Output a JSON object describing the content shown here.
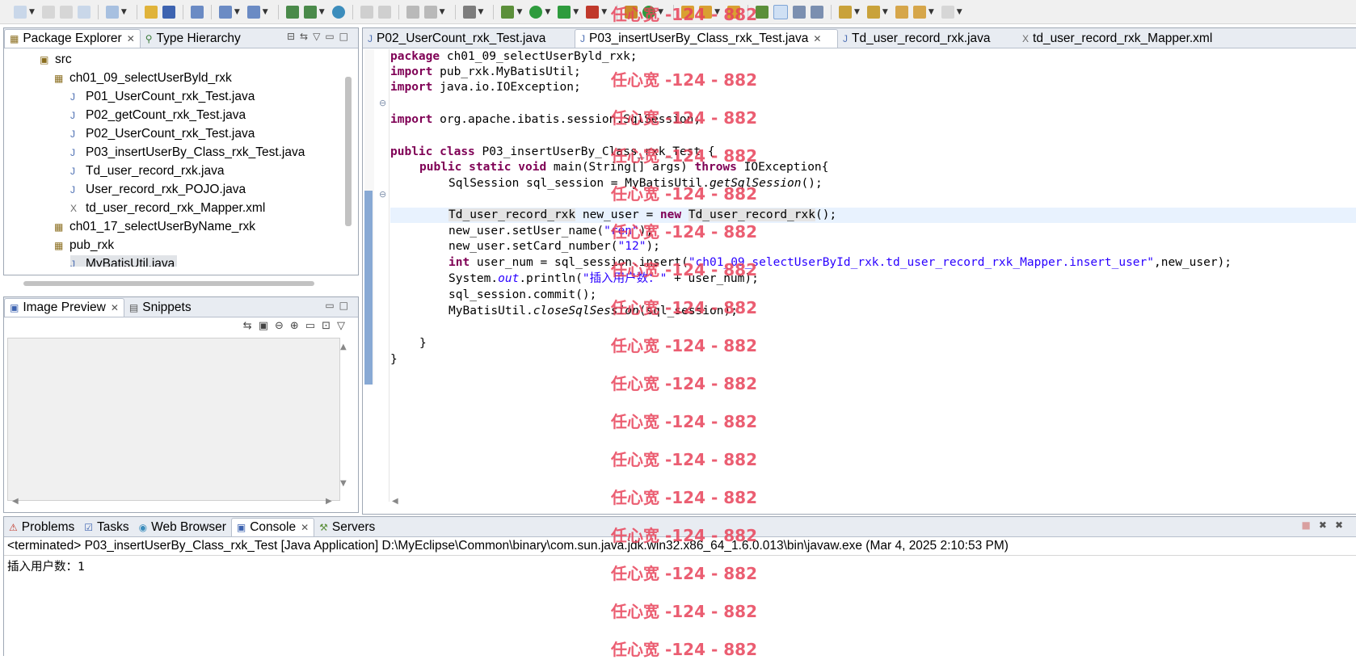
{
  "toolbar": {
    "icons": [
      "new-icon",
      "save-icon",
      "save-all-icon",
      "print-icon",
      "new-wizard-icon",
      "package-icon",
      "class-icon",
      "open-type-icon",
      "search-icon",
      "debug-icon",
      "run-icon",
      "run-as-icon",
      "external-tools-icon",
      "web-icon",
      "back-icon",
      "forward-icon"
    ]
  },
  "package_explorer": {
    "tab_label": "Package Explorer",
    "tab2_label": "Type Hierarchy",
    "items": [
      {
        "label": "src",
        "icon": "source-folder-icon"
      },
      {
        "label": "ch01_09_selectUserByld_rxk",
        "icon": "package-icon"
      },
      {
        "label": "P01_UserCount_rxk_Test.java",
        "icon": "java-file-icon"
      },
      {
        "label": "P02_getCount_rxk_Test.java",
        "icon": "java-file-icon"
      },
      {
        "label": "P02_UserCount_rxk_Test.java",
        "icon": "java-file-icon"
      },
      {
        "label": "P03_insertUserBy_Class_rxk_Test.java",
        "icon": "java-file-icon"
      },
      {
        "label": "Td_user_record_rxk.java",
        "icon": "java-file-icon"
      },
      {
        "label": "User_record_rxk_POJO.java",
        "icon": "java-file-icon"
      },
      {
        "label": "td_user_record_rxk_Mapper.xml",
        "icon": "xml-file-icon"
      },
      {
        "label": "ch01_17_selectUserByName_rxk",
        "icon": "package-icon"
      },
      {
        "label": "pub_rxk",
        "icon": "package-icon"
      },
      {
        "label": "MyBatisUtil.java",
        "icon": "java-file-icon"
      }
    ]
  },
  "image_preview": {
    "tab_label": "Image Preview",
    "tab2_label": "Snippets"
  },
  "editor": {
    "tabs": [
      {
        "label": "P02_UserCount_rxk_Test.java"
      },
      {
        "label": "P03_insertUserBy_Class_rxk_Test.java"
      },
      {
        "label": "Td_user_record_rxk.java"
      },
      {
        "label": "td_user_record_rxk_Mapper.xml"
      }
    ],
    "code": {
      "l1_kw": "package",
      "l1_rest": " ch01_09_selectUserByld_rxk;",
      "l2_kw": "import",
      "l2_rest": " pub_rxk.MyBatisUtil;",
      "l3_kw": "import",
      "l3_rest": " java.io.IOException;",
      "l5_kw": "import",
      "l5_rest": " org.apache.ibatis.session.SqlSession;",
      "l7_kw1": "public",
      "l7_kw2": "class",
      "l7_rest": " P03_insertUserBy_Class_rxk_Test {",
      "l8_kw1": "public",
      "l8_kw2": "static",
      "l8_kw3": "void",
      "l8_mid": " main(String[] args) ",
      "l8_kw4": "throws",
      "l8_rest": " IOException{",
      "l9_a": "SqlSession sql_session = MyBatisUtil.",
      "l9_it": "getSqlSession",
      "l9_b": "();",
      "l11_t1": "Td_user_record_rxk",
      "l11_mid": " new_user = ",
      "l11_kw": "new",
      "l11_t2": "Td_user_record_rxk",
      "l11_end": "();",
      "l12_a": "new_user.setUser_name(",
      "l12_s": "\"ren\"",
      "l12_b": ");",
      "l13_a": "new_user.setCard_number(",
      "l13_s": "\"12\"",
      "l13_b": ");",
      "l14_kw": "int",
      "l14_a": " user_num = sql_session.insert(",
      "l14_s": "\"ch01_09_selectUserById_rxk.td_user_record_rxk_Mapper.insert_user\"",
      "l14_b": ",new_user);",
      "l15_a": "System.",
      "l15_it": "out",
      "l15_b": ".println(",
      "l15_s": "\"插入用户数：\"",
      "l15_c": " + user_num);",
      "l16": "sql_session.commit();",
      "l17_a": "MyBatisUtil.",
      "l17_it": "closeSqlSession",
      "l17_b": "(sql_session);",
      "l19": "}",
      "l20": "}"
    }
  },
  "bottom": {
    "tabs": [
      {
        "label": "Problems"
      },
      {
        "label": "Tasks"
      },
      {
        "label": "Web Browser"
      },
      {
        "label": "Console"
      },
      {
        "label": "Servers"
      }
    ],
    "console_header": "<terminated> P03_insertUserBy_Class_rxk_Test [Java Application] D:\\MyEclipse\\Common\\binary\\com.sun.java.jdk.win32.x86_64_1.6.0.013\\bin\\javaw.exe (Mar 4, 2025 2:10:53 PM)",
    "console_output": "插入用户数：1"
  },
  "watermark": "任心宽 -124 - 882"
}
